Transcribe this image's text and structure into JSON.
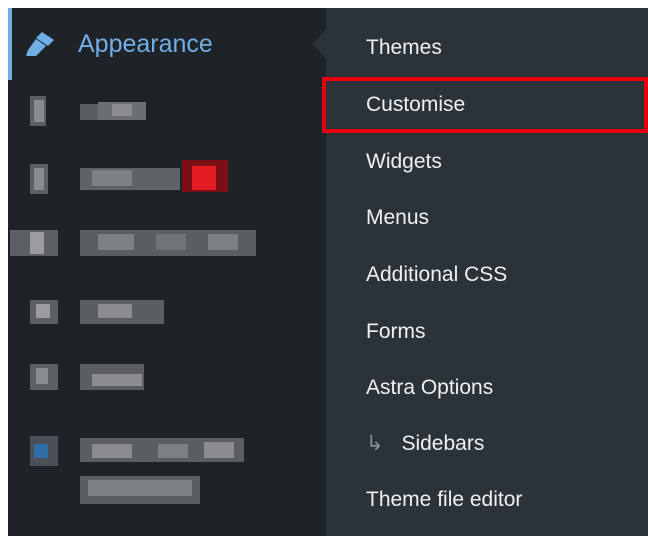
{
  "sidebar": {
    "active_item": {
      "label": "Appearance",
      "icon": "paintbrush-icon"
    }
  },
  "submenu": {
    "items": [
      {
        "label": "Themes"
      },
      {
        "label": "Customise"
      },
      {
        "label": "Widgets"
      },
      {
        "label": "Menus"
      },
      {
        "label": "Additional CSS"
      },
      {
        "label": "Forms"
      },
      {
        "label": "Astra Options"
      },
      {
        "label": "Sidebars",
        "prefix": "↳"
      },
      {
        "label": "Theme file editor"
      }
    ],
    "highlighted_item": "Customise"
  },
  "colors": {
    "sidebar_bg": "#1d2327",
    "submenu_bg": "#2c3338",
    "accent": "#72aee6",
    "highlight": "#e4000f",
    "text": "#f0f0f1"
  }
}
